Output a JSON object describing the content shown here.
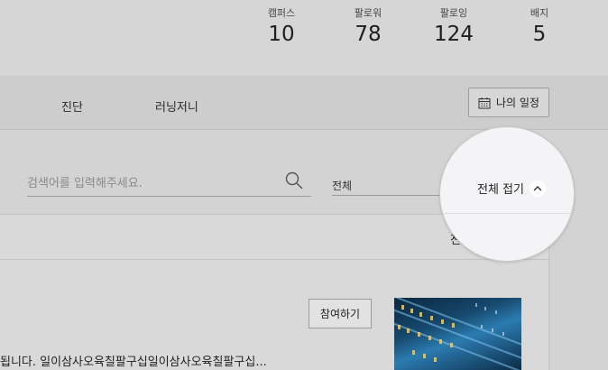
{
  "stats": [
    {
      "label": "캠퍼스",
      "value": "10"
    },
    {
      "label": "팔로워",
      "value": "78"
    },
    {
      "label": "팔로잉",
      "value": "124"
    },
    {
      "label": "배지",
      "value": "5"
    }
  ],
  "nav": {
    "items": [
      "진단",
      "러닝저니"
    ],
    "schedule_label": "나의 일정"
  },
  "search": {
    "placeholder": "검색어를 입력해주세요."
  },
  "filter_select": {
    "value": "전체"
  },
  "collapse": {
    "label": "전체 접기"
  },
  "item": {
    "join_label": "참여하기",
    "description": "됩니다. 일이삼사오육칠팔구십일이삼사오육칠팔구십..."
  },
  "colors": {
    "background": "#d4d4d4",
    "magnifier": "#f4f4f6"
  }
}
